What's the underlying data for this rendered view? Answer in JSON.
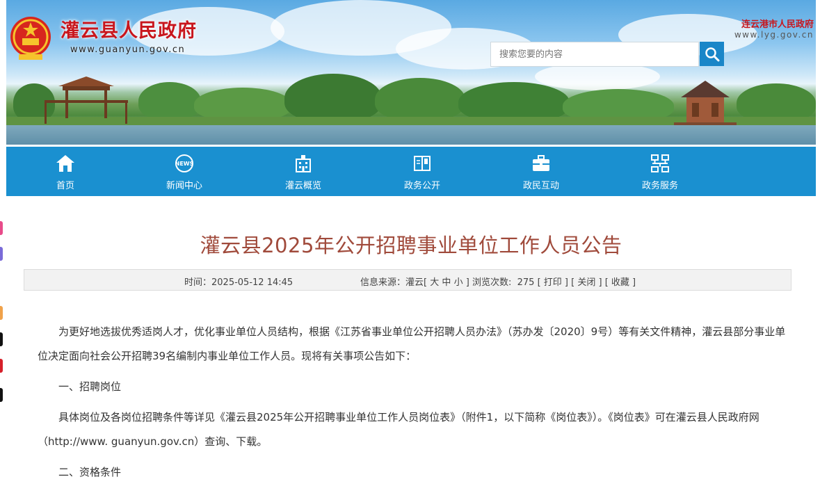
{
  "header": {
    "site_title": "灌云县人民政府",
    "site_url": "www.guanyun.gov.cn",
    "city_link": {
      "name": "连云港市人民政府",
      "url": "www.lyg.gov.cn"
    },
    "search": {
      "placeholder": "搜索您要的内容"
    }
  },
  "nav": {
    "items": [
      {
        "label": "首页",
        "icon": "home-icon"
      },
      {
        "label": "新闻中心",
        "icon": "news-icon"
      },
      {
        "label": "灌云概览",
        "icon": "building-icon"
      },
      {
        "label": "政务公开",
        "icon": "book-icon"
      },
      {
        "label": "政民互动",
        "icon": "briefcase-icon"
      },
      {
        "label": "政务服务",
        "icon": "network-icon"
      }
    ]
  },
  "article": {
    "title": "灌云县2025年公开招聘事业单位工作人员公告",
    "meta": {
      "time_label": "时间：",
      "time": "2025-05-12 14:45",
      "source_label": "信息来源：",
      "source": "灌云",
      "font_prefix": "[",
      "font_large": "大",
      "font_medium": "中",
      "font_small": "小",
      "font_suffix": "]",
      "views_label": "浏览次数:",
      "views": "275",
      "print": "[ 打印 ]",
      "close": "[ 关闭 ]",
      "favorite": "[ 收藏 ]"
    },
    "paragraphs": [
      "为更好地选拔优秀适岗人才，优化事业单位人员结构，根据《江苏省事业单位公开招聘人员办法》（苏办发〔2020〕9号）等有关文件精神，灌云县部分事业单位决定面向社会公开招聘39名编制内事业单位工作人员。现将有关事项公告如下：",
      "一、招聘岗位",
      "具体岗位及各岗位招聘条件等详见《灌云县2025年公开招聘事业单位工作人员岗位表》（附件1，以下简称《岗位表》）。《岗位表》可在灌云县人民政府网（http://www. guanyun.gov.cn）查询、下载。",
      "二、资格条件"
    ]
  },
  "colors": {
    "nav_bg": "#1a90d0",
    "title_red": "#c8161d",
    "article_title": "#a04a3b"
  }
}
